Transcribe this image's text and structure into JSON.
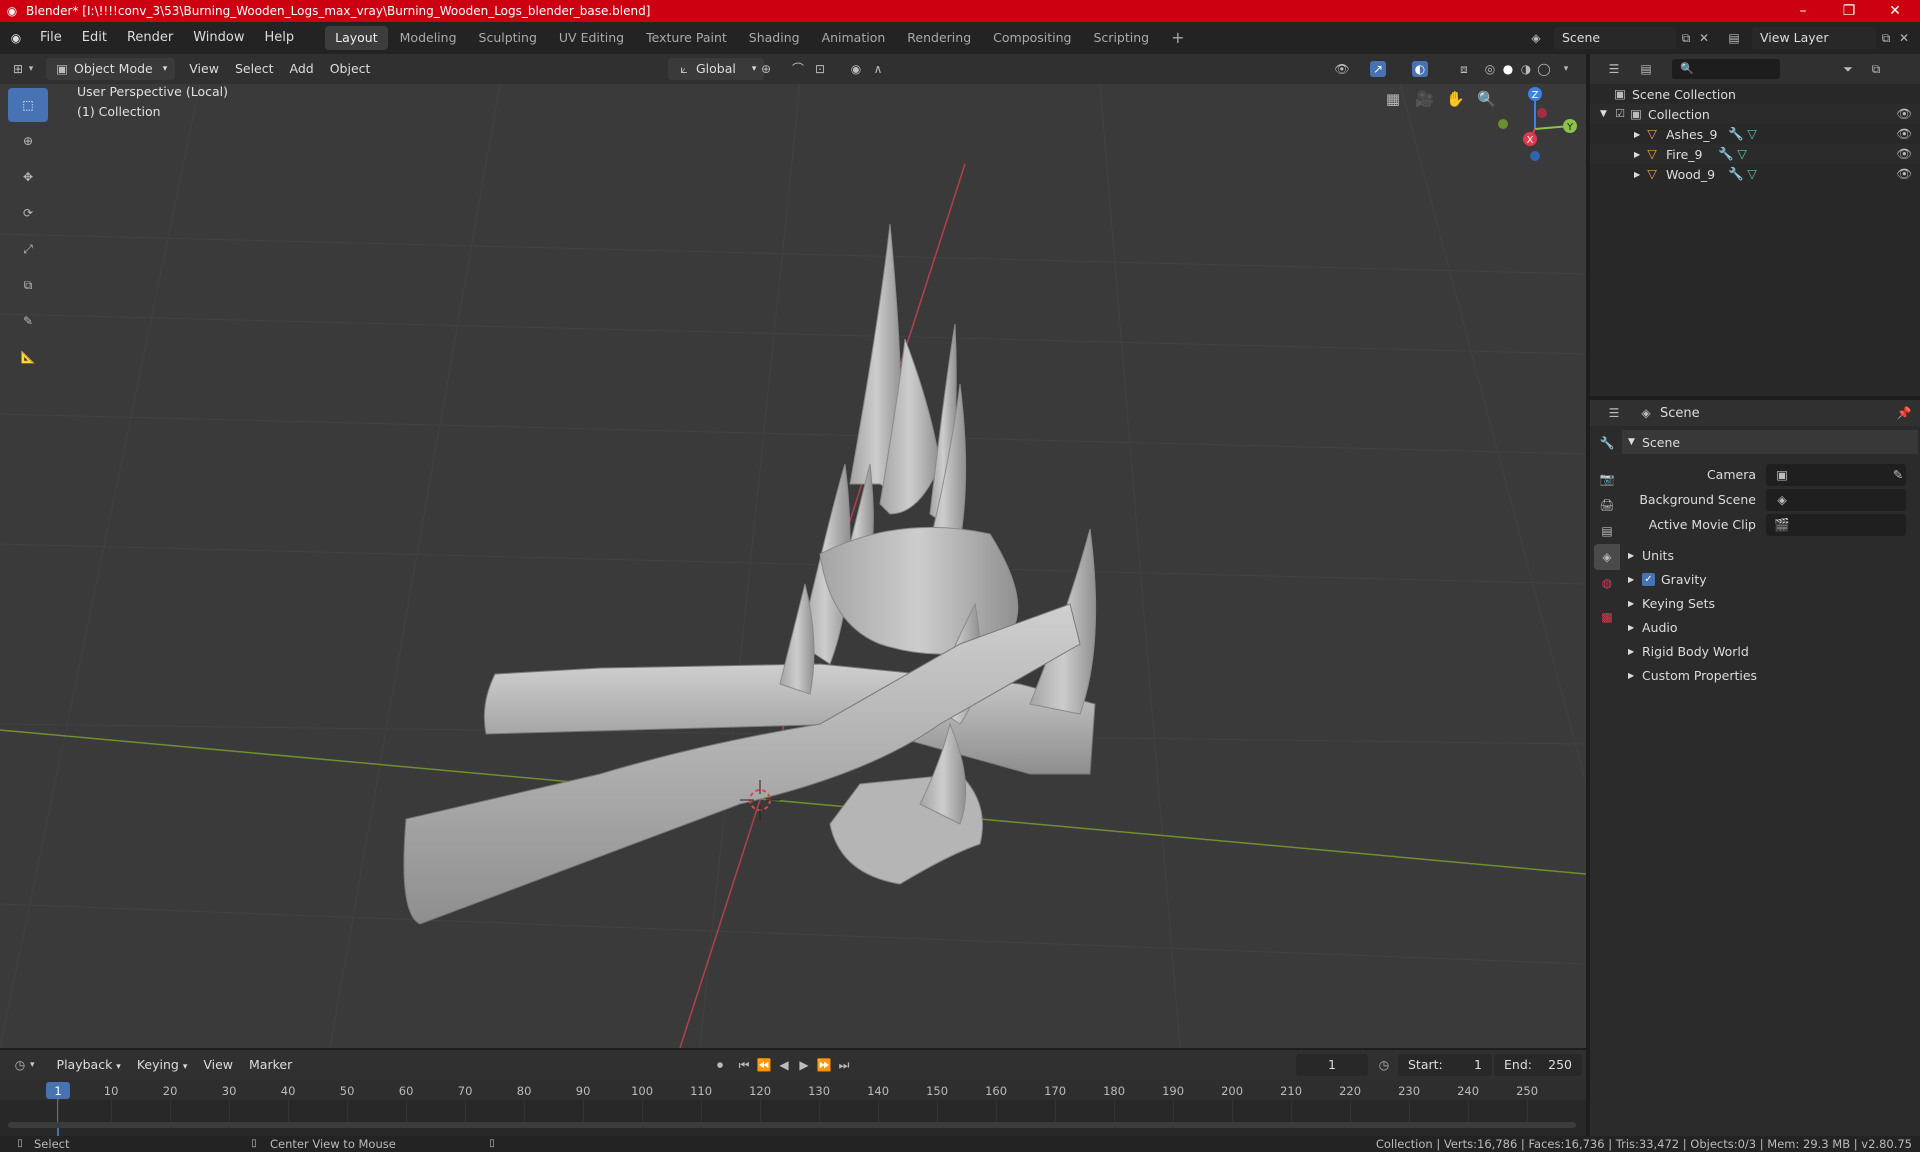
{
  "window": {
    "title": "Blender* [I:\\!!!!conv_3\\53\\Burning_Wooden_Logs_max_vray\\Burning_Wooden_Logs_blender_base.blend]",
    "minimize": "–",
    "maximize": "❐",
    "close": "✕"
  },
  "menubar": {
    "items": [
      "File",
      "Edit",
      "Render",
      "Window",
      "Help"
    ],
    "workspaces": [
      "Layout",
      "Modeling",
      "Sculpting",
      "UV Editing",
      "Texture Paint",
      "Shading",
      "Animation",
      "Rendering",
      "Compositing",
      "Scripting"
    ],
    "add_workspace": "+",
    "scene": "Scene",
    "view_layer": "View Layer"
  },
  "viewport_header": {
    "mode": "Object Mode",
    "menus": [
      "View",
      "Select",
      "Add",
      "Object"
    ],
    "orientation": "Global"
  },
  "viewport": {
    "perspective": "User Perspective (Local)",
    "collection": "(1) Collection",
    "gizmo": {
      "x": "X",
      "y": "Y",
      "z": "Z"
    }
  },
  "outliner": {
    "search_placeholder": "",
    "root": "Scene Collection",
    "collection": "Collection",
    "objects": [
      "Ashes_9",
      "Fire_9",
      "Wood_9"
    ]
  },
  "properties": {
    "header_title": "Scene",
    "panel_title": "Scene",
    "fields": [
      {
        "label": "Camera",
        "value": ""
      },
      {
        "label": "Background Scene",
        "value": ""
      },
      {
        "label": "Active Movie Clip",
        "value": ""
      }
    ],
    "subpanels": [
      "Units",
      "Gravity",
      "Keying Sets",
      "Audio",
      "Rigid Body World",
      "Custom Properties"
    ]
  },
  "timeline": {
    "menus": [
      "Playback",
      "Keying",
      "View",
      "Marker"
    ],
    "current_frame": "1",
    "start_label": "Start:",
    "start": "1",
    "end_label": "End:",
    "end": "250",
    "ruler": [
      "1",
      "10",
      "20",
      "30",
      "40",
      "50",
      "60",
      "70",
      "80",
      "90",
      "100",
      "110",
      "120",
      "130",
      "140",
      "150",
      "160",
      "170",
      "180",
      "190",
      "200",
      "210",
      "220",
      "230",
      "240",
      "250"
    ]
  },
  "statusbar": {
    "select": "Select",
    "center_view": "Center View to Mouse",
    "stats": "Collection | Verts:16,786 | Faces:16,736 | Tris:33,472 | Objects:0/3 | Mem: 29.3 MB | v2.80.75"
  },
  "colors": {
    "titlebar": "#cc0011",
    "accent": "#4772b3",
    "x_axis": "#e0384f",
    "y_axis": "#8bc34a",
    "z_axis": "#3a83e0",
    "object_icon": "#f0a040",
    "modifier_icon": "#5aa0e0",
    "mesh_icon": "#4ec9b0"
  }
}
